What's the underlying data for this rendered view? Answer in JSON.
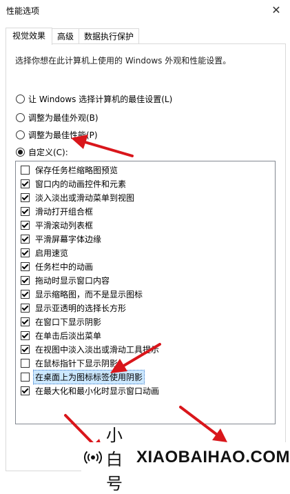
{
  "window": {
    "title": "性能选项",
    "close_symbol": "✕"
  },
  "tabs": [
    {
      "label": "视觉效果",
      "active": true
    },
    {
      "label": "高级",
      "active": false
    },
    {
      "label": "数据执行保护",
      "active": false
    }
  ],
  "intro_text": "选择你想在此计算机上使用的 Windows 外观和性能设置。",
  "radio_options": [
    {
      "label": "让 Windows 选择计算机的最佳设置(L)",
      "checked": false
    },
    {
      "label": "调整为最佳外观(B)",
      "checked": false
    },
    {
      "label": "调整为最佳性能(P)",
      "checked": false
    },
    {
      "label": "自定义(C):",
      "checked": true
    }
  ],
  "effects": [
    {
      "label": "保存任务栏缩略图预览",
      "checked": false
    },
    {
      "label": "窗口内的动画控件和元素",
      "checked": true
    },
    {
      "label": "淡入淡出或滑动菜单到视图",
      "checked": true
    },
    {
      "label": "滑动打开组合框",
      "checked": true
    },
    {
      "label": "平滑滚动列表框",
      "checked": true
    },
    {
      "label": "平滑屏幕字体边缘",
      "checked": true
    },
    {
      "label": "启用速览",
      "checked": true
    },
    {
      "label": "任务栏中的动画",
      "checked": true
    },
    {
      "label": "拖动时显示窗口内容",
      "checked": true
    },
    {
      "label": "显示缩略图，而不是显示图标",
      "checked": true
    },
    {
      "label": "显示亚透明的选择长方形",
      "checked": true
    },
    {
      "label": "在窗口下显示阴影",
      "checked": true
    },
    {
      "label": "在单击后淡出菜单",
      "checked": true
    },
    {
      "label": "在视图中淡入淡出或滑动工具提示",
      "checked": true
    },
    {
      "label": "在鼠标指针下显示阴影",
      "checked": false
    },
    {
      "label": "在桌面上为图标标签使用阴影",
      "checked": false,
      "selected": true
    },
    {
      "label": "在最大化和最小化时显示窗口动画",
      "checked": true
    }
  ],
  "watermark": {
    "brand_cn": "小白号",
    "brand_en": "XIAOBAIHAO.COM"
  },
  "colors": {
    "arrow": "#d9161b",
    "selection_bg": "#cce8ff",
    "selection_border": "#0a64c8"
  }
}
